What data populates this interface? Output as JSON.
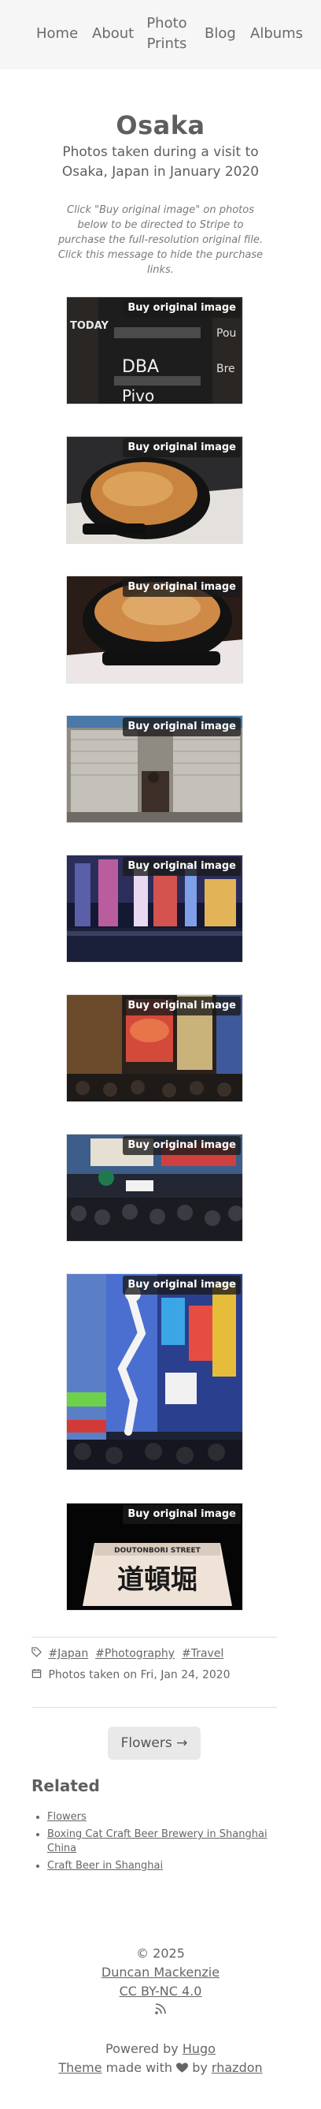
{
  "nav": {
    "home": "Home",
    "about": "About",
    "prints": "Photo Prints",
    "blog": "Blog",
    "albums": "Albums"
  },
  "album": {
    "title": "Osaka",
    "subtitle": "Photos taken during a visit to Osaka, Japan in January 2020",
    "purchase_note": "Click \"Buy original image\" on photos below to be directed to Stripe to purchase the full-resolution original file. Click this message to hide the purchase links.",
    "buy_label": "Buy original image"
  },
  "photos": [
    {
      "desc": "chalkboard menu",
      "sign_text": "TODAY DBA Pivo"
    },
    {
      "desc": "gyoza in skillet"
    },
    {
      "desc": "gyoza close-up"
    },
    {
      "desc": "street musician"
    },
    {
      "desc": "canal at night"
    },
    {
      "desc": "crab sign street"
    },
    {
      "desc": "crowded street"
    },
    {
      "desc": "glico sign"
    },
    {
      "desc": "dotonbori sign",
      "sign_text": "DOTONBORI STREET 道頓堀"
    }
  ],
  "meta": {
    "tags": [
      "#Japan",
      "#Photography",
      "#Travel"
    ],
    "date": "Photos taken on Fri, Jan 24, 2020"
  },
  "next": {
    "label": "Flowers →"
  },
  "related": {
    "title": "Related",
    "items": [
      "Flowers",
      "Boxing Cat Craft Beer Brewery in Shanghai China",
      "Craft Beer in Shanghai"
    ]
  },
  "footer": {
    "copyright": "© 2025",
    "author": "Duncan Mackenzie",
    "license": "CC BY-NC 4.0",
    "powered_prefix": "Powered by ",
    "powered_link": "Hugo",
    "theme_link": "Theme",
    "theme_mid": " made with ",
    "theme_by": " by ",
    "theme_author": "rhazdon"
  },
  "icons": {
    "tag": "tag-icon",
    "calendar": "calendar-icon",
    "rss": "rss-icon",
    "heart": "heart-icon"
  }
}
